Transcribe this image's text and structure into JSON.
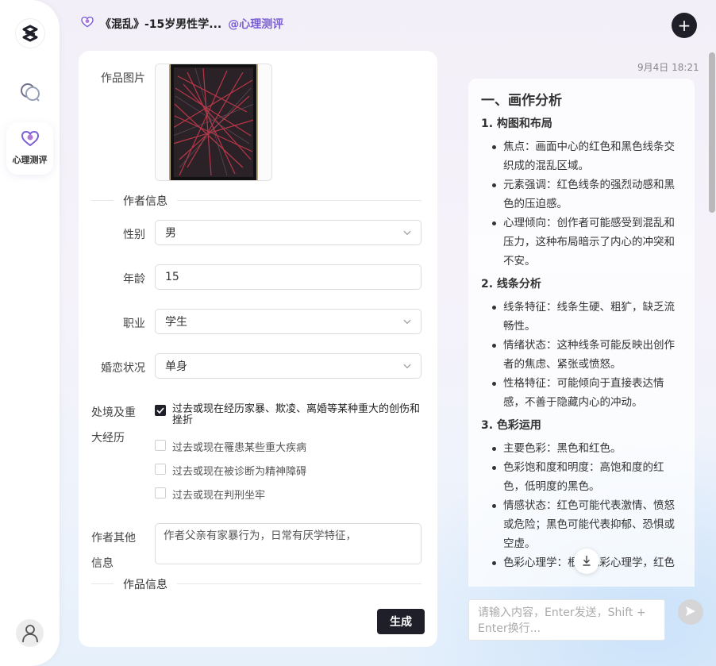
{
  "app": {
    "chat_title": "《混乱》-15岁男性学...",
    "mention": "@心理测评"
  },
  "sidebar": {
    "active_label": "心理测评"
  },
  "form": {
    "image_label": "作品图片",
    "author_section": "作者信息",
    "gender_label": "性别",
    "gender_value": "男",
    "age_label": "年龄",
    "age_value": "15",
    "job_label": "职业",
    "job_value": "学生",
    "marital_label": "婚恋状况",
    "marital_value": "单身",
    "experience_label_1": "处境及重",
    "experience_label_2": "大经历",
    "experiences": [
      {
        "text": "过去或现在经历家暴、欺凌、离婚等某种重大的创伤和挫折",
        "checked": true
      },
      {
        "text": "过去或现在罹患某些重大疾病",
        "checked": false
      },
      {
        "text": "过去或现在被诊断为精神障碍",
        "checked": false
      },
      {
        "text": "过去或现在判刑坐牢",
        "checked": false
      }
    ],
    "other_label_1": "作者其他",
    "other_label_2": "信息",
    "other_value": "作者父亲有家暴行为，日常有厌学特征，",
    "work_section": "作品信息",
    "generate_label": "生成"
  },
  "chat": {
    "timestamp": "9月4日 18:21",
    "heading": "一、画作分析",
    "sections": [
      {
        "title": "1. 构图和布局",
        "items": [
          "焦点：画面中心的红色和黑色线条交织成的混乱区域。",
          "元素强调：红色线条的强烈动感和黑色的压迫感。",
          "心理倾向：创作者可能感受到混乱和压力，这种布局暗示了内心的冲突和不安。"
        ]
      },
      {
        "title": "2. 线条分析",
        "items": [
          "线条特征：线条生硬、粗犷，缺乏流畅性。",
          "情绪状态：这种线条可能反映出创作者的焦虑、紧张或愤怒。",
          "性格特征：可能倾向于直接表达情感，不善于隐藏内心的冲动。"
        ]
      },
      {
        "title": "3. 色彩运用",
        "items": [
          "主要色彩：黑色和红色。",
          "色彩饱和度和明度：高饱和度的红色，低明度的黑色。",
          "情感状态：红色可能代表激情、愤怒或危险；黑色可能代表抑郁、恐惧或空虚。",
          "色彩心理学：根据色彩心理学，红色"
        ]
      }
    ],
    "input_placeholder": "请输入内容，Enter发送，Shift + Enter换行..."
  },
  "icons": {
    "logo": "logo-icon",
    "chat_nav": "chat-bubbles-icon",
    "assessment_nav": "heart-chat-icon",
    "user": "user-icon",
    "add": "plus-icon",
    "scroll": "arrow-down-icon",
    "send": "send-icon"
  },
  "colors": {
    "accent": "#7b5fd6",
    "dark": "#1f1f2a"
  }
}
